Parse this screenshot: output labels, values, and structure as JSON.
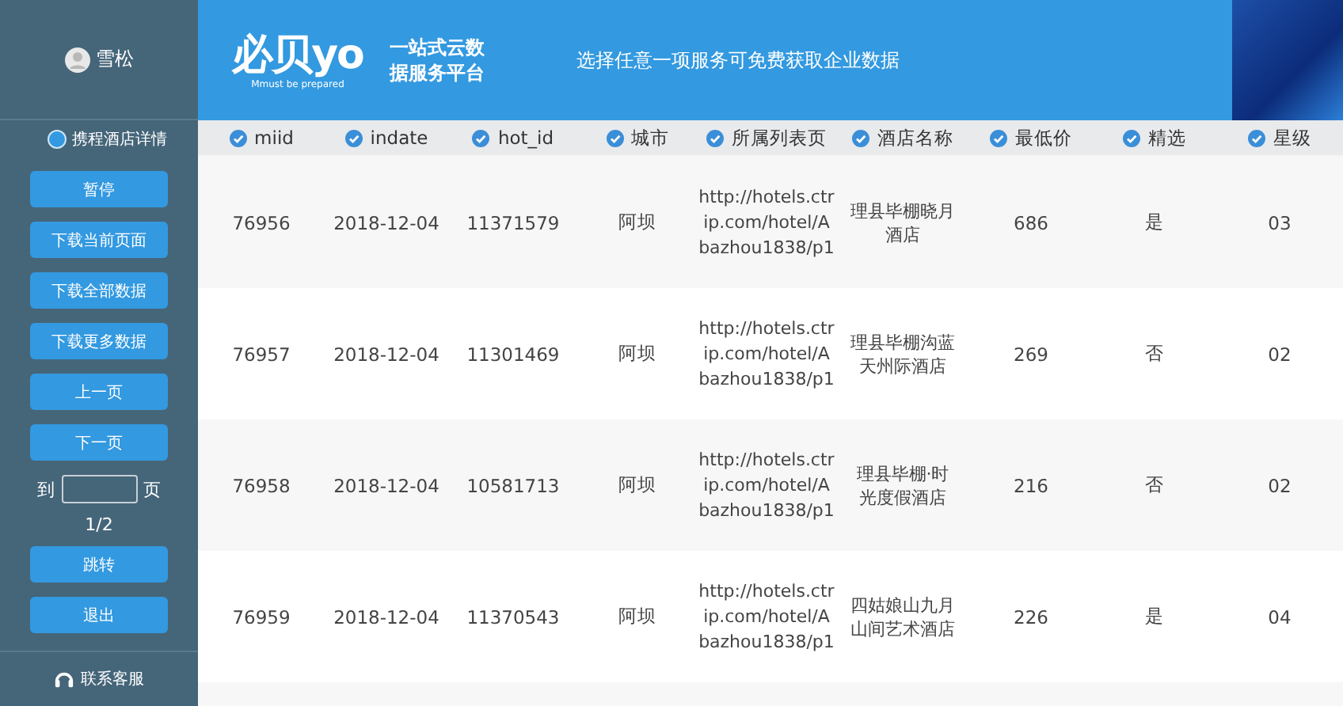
{
  "user": {
    "name": "雪松"
  },
  "header": {
    "logo_text": "必贝yo",
    "logo_tagline": "Mmust be prepared",
    "platform": "一站式云数据服务平台",
    "slogan": "选择任意一项服务可免费获取企业数据"
  },
  "sidebar": {
    "source": {
      "label": "携程酒店详情",
      "selected": true
    },
    "buttons": [
      "暂停",
      "下载当前页面",
      "下载全部数据",
      "下载更多数据",
      "上一页",
      "下一页"
    ],
    "goto": {
      "prefix": "到",
      "suffix": "页"
    },
    "page_info": "1/2",
    "buttons_bottom": [
      "跳转",
      "退出"
    ],
    "contact": "联系客服"
  },
  "table": {
    "columns": [
      {
        "label": "miid",
        "checked": true
      },
      {
        "label": "indate",
        "checked": true
      },
      {
        "label": "hot_id",
        "checked": true
      },
      {
        "label": "城市",
        "checked": true
      },
      {
        "label": "所属列表页",
        "checked": true
      },
      {
        "label": "酒店名称",
        "checked": true
      },
      {
        "label": "最低价",
        "checked": true
      },
      {
        "label": "精选",
        "checked": true
      },
      {
        "label": "星级",
        "checked": true
      }
    ],
    "rows": [
      [
        "76956",
        "2018-12-04",
        "11371579",
        "阿坝",
        "http://hotels.ctrip.com/hotel/Abazhou1838/p1",
        "理县毕棚晓月酒店",
        "686",
        "是",
        "03"
      ],
      [
        "76957",
        "2018-12-04",
        "11301469",
        "阿坝",
        "http://hotels.ctrip.com/hotel/Abazhou1838/p1",
        "理县毕棚沟蓝天州际酒店",
        "269",
        "否",
        "02"
      ],
      [
        "76958",
        "2018-12-04",
        "10581713",
        "阿坝",
        "http://hotels.ctrip.com/hotel/Abazhou1838/p1",
        "理县毕棚·时光度假酒店",
        "216",
        "否",
        "02"
      ],
      [
        "76959",
        "2018-12-04",
        "11370543",
        "阿坝",
        "http://hotels.ctrip.com/hotel/Abazhou1838/p1",
        "四姑娘山九月山间艺术酒店",
        "226",
        "是",
        "04"
      ]
    ]
  }
}
